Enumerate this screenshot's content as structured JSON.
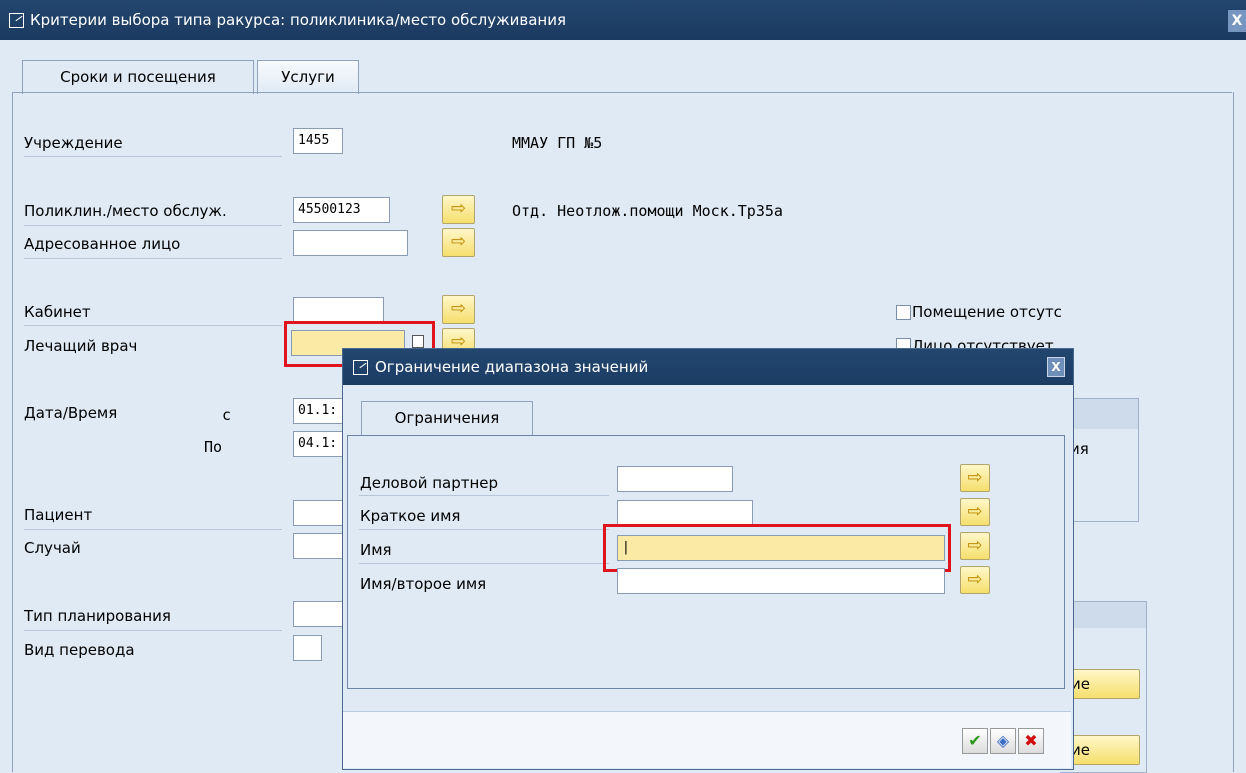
{
  "window": {
    "title": "Критерии выбора типа ракурса: поликлиника/место обслуживания"
  },
  "tabs": [
    {
      "label": "Сроки и посещения",
      "active": true
    },
    {
      "label": "Услуги",
      "active": false
    }
  ],
  "form": {
    "institution": {
      "label": "Учреждение",
      "value": "1455",
      "text": "ММАУ ГП №5"
    },
    "clinic": {
      "label": "Поликлин./место обслуж.",
      "value": "45500123",
      "text": "Отд. Неотлож.помощи Моск.Тр35а"
    },
    "addressee": {
      "label": "Адресованное лицо",
      "value": ""
    },
    "cabinet": {
      "label": "Кабинет",
      "value": ""
    },
    "doctor": {
      "label": "Лечащий врач",
      "value": ""
    },
    "datetime": {
      "label": "Дата/Время",
      "from_label": "с",
      "from_value": "01.1:",
      "to_label": "По",
      "to_value": "04.1:"
    },
    "patient": {
      "label": "Пациент",
      "value": ""
    },
    "case": {
      "label": "Случай",
      "value": ""
    },
    "planning_type": {
      "label": "Тип планирования",
      "value": ""
    },
    "transfer_type": {
      "label": "Вид перевода",
      "value": ""
    },
    "room_missing": {
      "label": "Помещение отсутс",
      "checked": false
    },
    "person_missing": {
      "label": "Лицо отсутствует",
      "checked": false
    },
    "partial_right": "ия",
    "btn_partial_1": "ие",
    "btn_partial_2": "ие"
  },
  "dialog": {
    "title": "Ограничение диапазона значений",
    "tab": "Ограничения",
    "fields": [
      {
        "label": "Деловой партнер",
        "value": ""
      },
      {
        "label": "Краткое имя",
        "value": ""
      },
      {
        "label": "Имя",
        "value": "|"
      },
      {
        "label": "Имя/второе имя",
        "value": ""
      }
    ]
  },
  "icons": {
    "pick_arrow": "⇨",
    "ok": "✔",
    "multi": "◈",
    "cancel": "✖",
    "close": "X"
  },
  "colors": {
    "title_bg": "#1b3a60",
    "window_bg": "#dfeaf5",
    "required_field": "#fbe9a6",
    "highlight": "#e0141c",
    "button_yellow": "#f5df6d"
  }
}
